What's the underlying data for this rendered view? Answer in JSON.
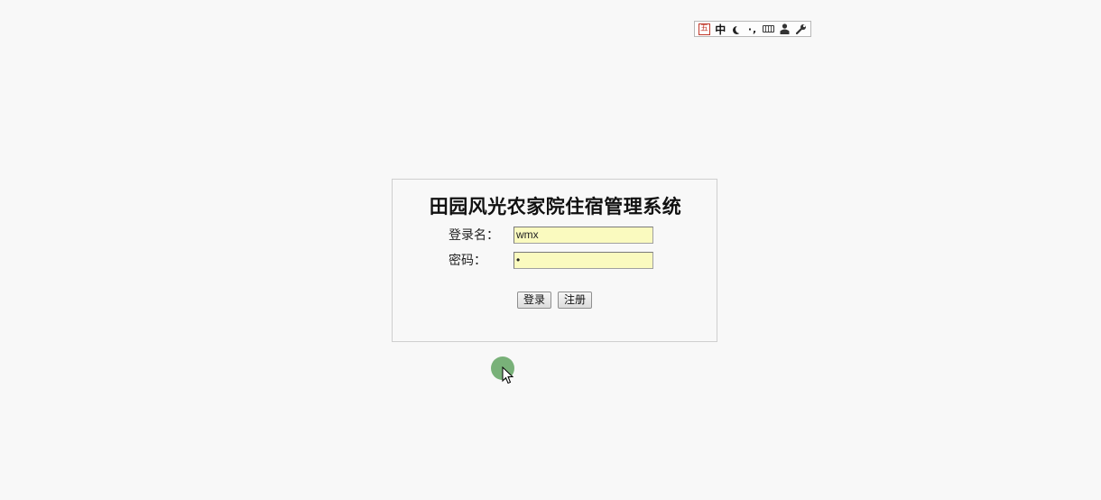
{
  "ime_toolbar": {
    "logo_text": "五",
    "mode_label": "中",
    "punct_label": "·,"
  },
  "login": {
    "title": "田园风光农家院住宿管理系统",
    "username_label": "登录名：",
    "username_value": "wmx",
    "password_label": "密码：",
    "password_value": "•",
    "login_button": "登录",
    "register_button": "注册"
  }
}
